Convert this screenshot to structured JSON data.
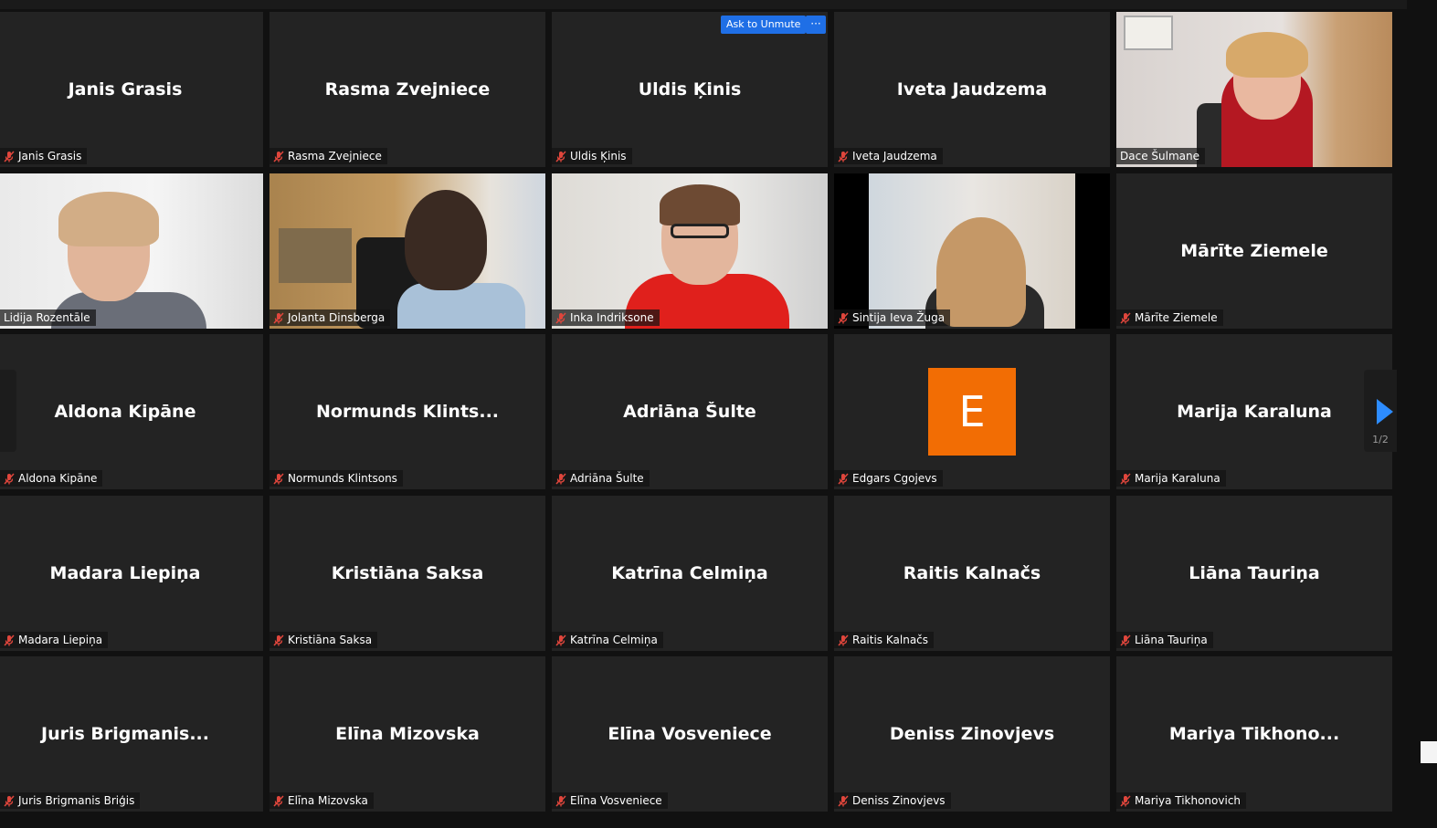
{
  "meeting": {
    "ask_to_unmute_label": "Ask to Unmute",
    "more_label": "···",
    "page_indicator": "1/2"
  },
  "participants": [
    {
      "display": "Janis Grasis",
      "label": "Janis Grasis",
      "video": false,
      "muted": true
    },
    {
      "display": "Rasma Zvejniece",
      "label": "Rasma Zvejniece",
      "video": false,
      "muted": true
    },
    {
      "display": "Uldis Ķinis",
      "label": "Uldis Ķinis",
      "video": false,
      "muted": true
    },
    {
      "display": "Iveta Jaudzema",
      "label": "Iveta Jaudzema",
      "video": false,
      "muted": true
    },
    {
      "display": "",
      "label": "Dace Šulmane",
      "video": true,
      "muted": false,
      "active": true
    },
    {
      "display": "",
      "label": "Lidija Rozentāle",
      "video": true,
      "muted": false
    },
    {
      "display": "",
      "label": "Jolanta Dinsberga",
      "video": true,
      "muted": true
    },
    {
      "display": "",
      "label": "Inka Indriksone",
      "video": true,
      "muted": true
    },
    {
      "display": "",
      "label": "Sintija Ieva Žuga",
      "video": true,
      "muted": true
    },
    {
      "display": "Mārīte Ziemele",
      "label": "Mārīte Ziemele",
      "video": false,
      "muted": true
    },
    {
      "display": "Aldona Kipāne",
      "label": "Aldona Kipāne",
      "video": false,
      "muted": true
    },
    {
      "display": "Normunds  Klints...",
      "label": "Normunds Klintsons",
      "video": false,
      "muted": true
    },
    {
      "display": "Adriāna Šulte",
      "label": "Adriāna Šulte",
      "video": false,
      "muted": true
    },
    {
      "display": "E",
      "label": "Edgars Cgojevs",
      "video": false,
      "muted": true,
      "avatar": true
    },
    {
      "display": "Marija Karaluna",
      "label": "Marija Karaluna",
      "video": false,
      "muted": true
    },
    {
      "display": "Madara Liepiņa",
      "label": "Madara Liepiņa",
      "video": false,
      "muted": true
    },
    {
      "display": "Kristiāna Saksa",
      "label": "Kristiāna Saksa",
      "video": false,
      "muted": true
    },
    {
      "display": "Katrīna Celmiņa",
      "label": "Katrīna Celmiņa",
      "video": false,
      "muted": true
    },
    {
      "display": "Raitis Kalnačs",
      "label": "Raitis Kalnačs",
      "video": false,
      "muted": true
    },
    {
      "display": "Liāna Tauriņa",
      "label": "Liāna Tauriņa",
      "video": false,
      "muted": true
    },
    {
      "display": "Juris  Brigmanis...",
      "label": "Juris Brigmanis Briģis",
      "video": false,
      "muted": true
    },
    {
      "display": "Elīna Mizovska",
      "label": "Elīna Mizovska",
      "video": false,
      "muted": true
    },
    {
      "display": "Elīna Vosveniece",
      "label": "Elīna Vosveniece",
      "video": false,
      "muted": true
    },
    {
      "display": "Deniss Zinovjevs",
      "label": "Deniss Zinovjevs",
      "video": false,
      "muted": true
    },
    {
      "display": "Mariya  Tikhono...",
      "label": "Mariya Tikhonovich",
      "video": false,
      "muted": true
    }
  ],
  "colors": {
    "tile_bg": "#232323",
    "active_border": "#c8e05a",
    "accent_blue": "#1f6fe6",
    "avatar_orange": "#f26d04",
    "mic_muted_red": "#e0463c"
  }
}
